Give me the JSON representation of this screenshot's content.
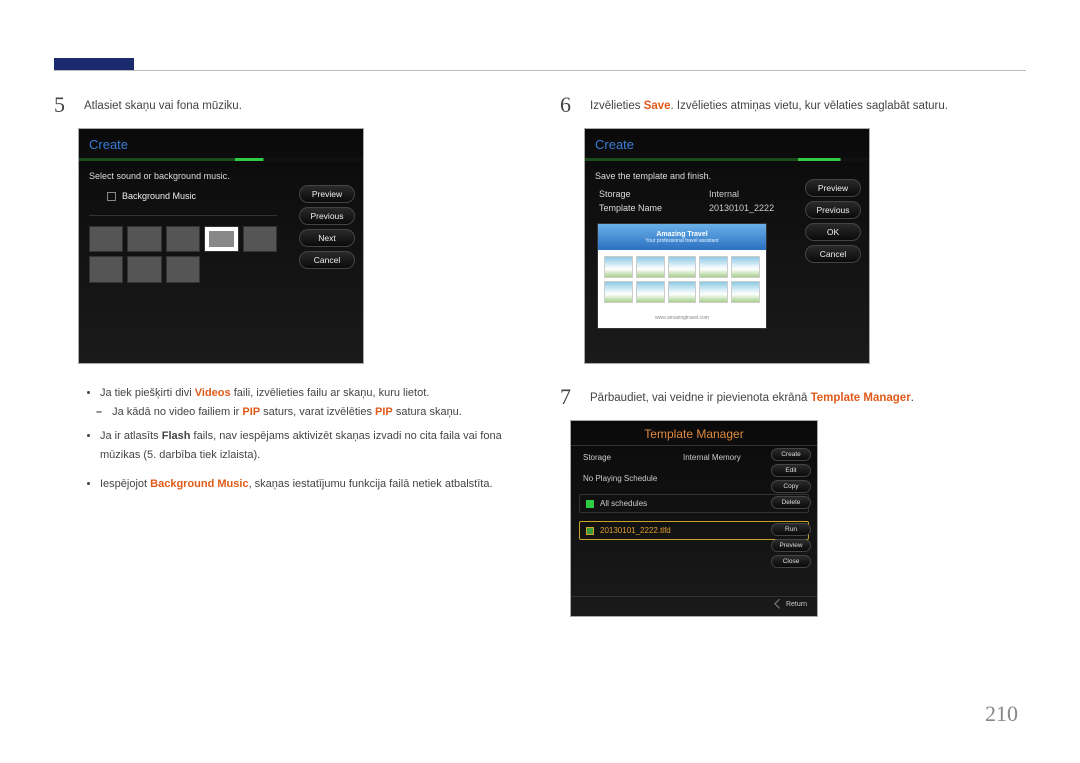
{
  "page_number": "210",
  "steps": {
    "s5": {
      "num": "5",
      "text_before": "Atlasiet skaņu vai fona mūziku."
    },
    "s6": {
      "num": "6",
      "text_before": "Izvēlieties ",
      "save": "Save",
      "text_after": ". Izvēlieties atmiņas vietu, kur vēlaties saglabāt saturu."
    },
    "s7": {
      "num": "7",
      "text_before": "Pārbaudiet, vai veidne ir pievienota ekrānā ",
      "tm": "Template Manager",
      "text_after": "."
    }
  },
  "panel5": {
    "title": "Create",
    "subtitle": "Select sound or background music.",
    "bg_music": "Background Music",
    "buttons": {
      "preview": "Preview",
      "previous": "Previous",
      "next": "Next",
      "cancel": "Cancel"
    }
  },
  "panel6": {
    "title": "Create",
    "subtitle": "Save the template and finish.",
    "storage_k": "Storage",
    "storage_v": "Internal",
    "tname_k": "Template Name",
    "tname_v": "20130101_2222",
    "banner_title": "Amazing Travel",
    "banner_sub": "Your professional travel assistant",
    "banner_footer": "www.amazingtravel.com",
    "buttons": {
      "preview": "Preview",
      "previous": "Previous",
      "ok": "OK",
      "cancel": "Cancel"
    }
  },
  "bullets5": {
    "b1_a": "Ja tiek piešķirti divi ",
    "b1_videos": "Videos",
    "b1_b": " faili, izvēlieties failu ar skaņu, kuru lietot.",
    "sub_a": "Ja kādā no video failiem ir ",
    "sub_pip1": "PIP",
    "sub_b": " saturs, varat izvēlēties ",
    "sub_pip2": "PIP",
    "sub_c": " satura skaņu.",
    "b2_a": "Ja ir atlasīts ",
    "b2_flash": "Flash",
    "b2_b": " fails, nav iespējams aktivizēt skaņas izvadi no cita faila vai fona mūzikas (5. darbība tiek izlaista).",
    "b3_a": "Iespējojot ",
    "b3_bg": "Background Music",
    "b3_b": ", skaņas iestatījumu funkcija failā netiek atbalstīta."
  },
  "tm_panel": {
    "title": "Template Manager",
    "storage_k": "Storage",
    "storage_v": "Internal Memory",
    "no_sched": "No Playing Schedule",
    "all": "All schedules",
    "file": "20130101_2222.tlfd",
    "buttons": {
      "create": "Create",
      "edit": "Edit",
      "copy": "Copy",
      "delete": "Delete",
      "run": "Run",
      "preview": "Preview",
      "close": "Close"
    },
    "return": "Return"
  }
}
